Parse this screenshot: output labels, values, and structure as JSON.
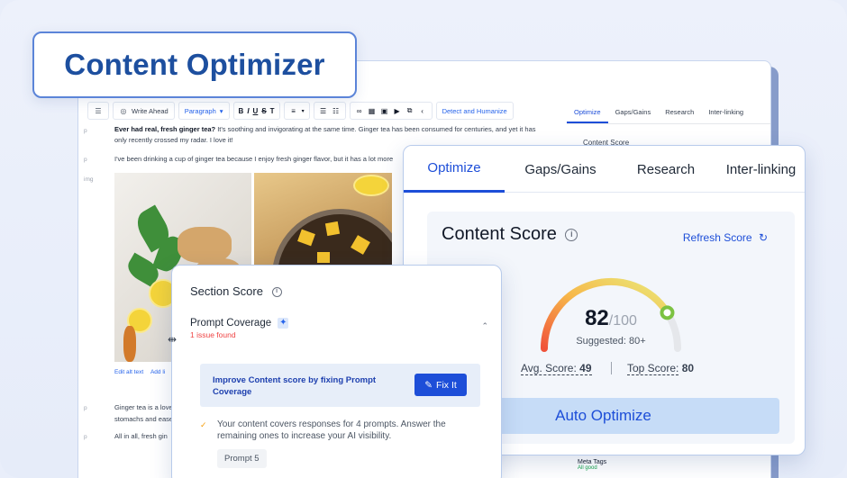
{
  "title_badge": "Content Optimizer",
  "editor": {
    "toolbar": {
      "write_ahead": "Write Ahead",
      "paragraph": "Paragraph",
      "format_buttons": [
        "B",
        "I",
        "U",
        "S",
        "T"
      ],
      "detect_humanize": "Detect and Humanize"
    },
    "row_tags": [
      "p",
      "p",
      "img",
      "p",
      "p"
    ],
    "para1_bold": "Ever had real, fresh ginger tea?",
    "para1_rest": " It's soothing and invigorating at the same time. Ginger tea has been consumed for centuries, and yet it has only recently crossed my radar. I love it!",
    "para2": "I've been drinking a cup of ginger tea because I enjoy fresh ginger flavor, but it has a lot more",
    "edit_alt_text": "Edit alt text",
    "add_link": "Add li",
    "para3": "Ginger tea is a love stomachs and ease",
    "para4": "All in all, fresh gin",
    "right_tabs": [
      "Optimize",
      "Gaps/Gains",
      "Research",
      "Inter-linking"
    ],
    "content_score_partial": "Content Score",
    "meta_tags": "Meta Tags",
    "meta_status": "All good"
  },
  "optimize_panel": {
    "tabs": [
      "Optimize",
      "Gaps/Gains",
      "Research",
      "Inter-linking"
    ],
    "active_tab": "Optimize",
    "content_score_label": "Content Score",
    "refresh_label": "Refresh Score",
    "score": "82",
    "score_max": "/100",
    "score_value": 82,
    "suggested": "Suggested: 80+",
    "avg_label": "Avg. Score:",
    "avg_value": "49",
    "top_label": "Top Score:",
    "top_value": "80",
    "auto_optimize": "Auto Optimize"
  },
  "section_panel": {
    "title": "Section Score",
    "prompt_coverage": "Prompt Coverage",
    "issue": "1 issue found",
    "improve_text": "Improve Content score by fixing Prompt Coverage",
    "fix_button": "Fix It",
    "covers_text": "Your content covers responses for 4 prompts. Answer the remaining ones to increase your AI visibility.",
    "prompt_chip": "Prompt 5"
  },
  "colors": {
    "accent": "#1d4ed8",
    "badge_text": "#1d4f9f",
    "issue_red": "#ef4444",
    "gauge_green": "#7cc242"
  }
}
